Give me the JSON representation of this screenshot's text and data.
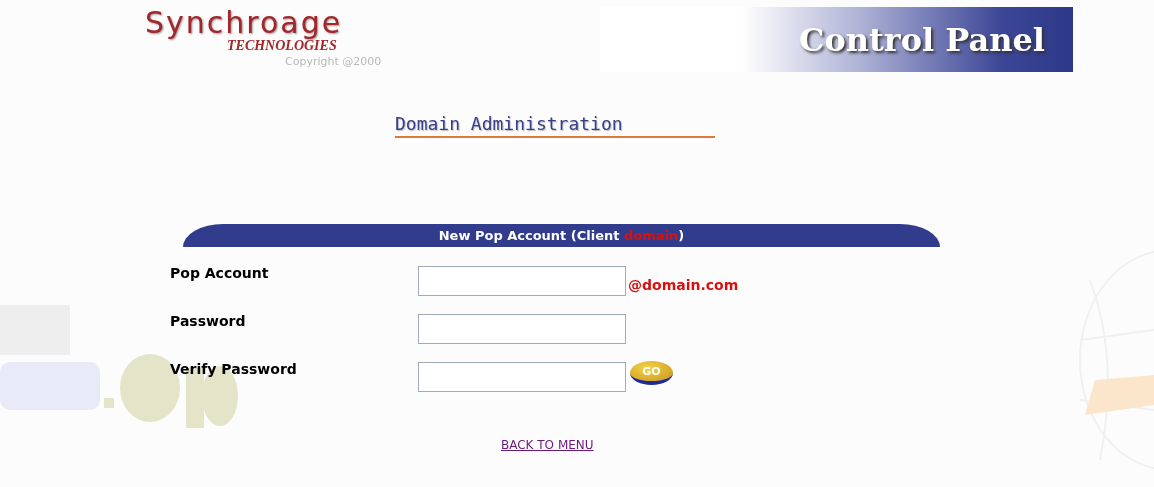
{
  "logo": {
    "name": "Synchroage",
    "subtitle": "TECHNOLOGIES",
    "copyright": "Copyright @2000"
  },
  "banner": {
    "title": "Control Panel"
  },
  "heading": "Domain Administration",
  "form": {
    "title": "New Pop Account (Client ",
    "client": "domain",
    "title_end": ")",
    "fields": [
      {
        "label": "Pop Account",
        "suffix": "@domain.com"
      },
      {
        "label": "Password"
      },
      {
        "label": "Verify Password",
        "button": "GO"
      }
    ]
  },
  "back_link": "BACK TO MENU"
}
